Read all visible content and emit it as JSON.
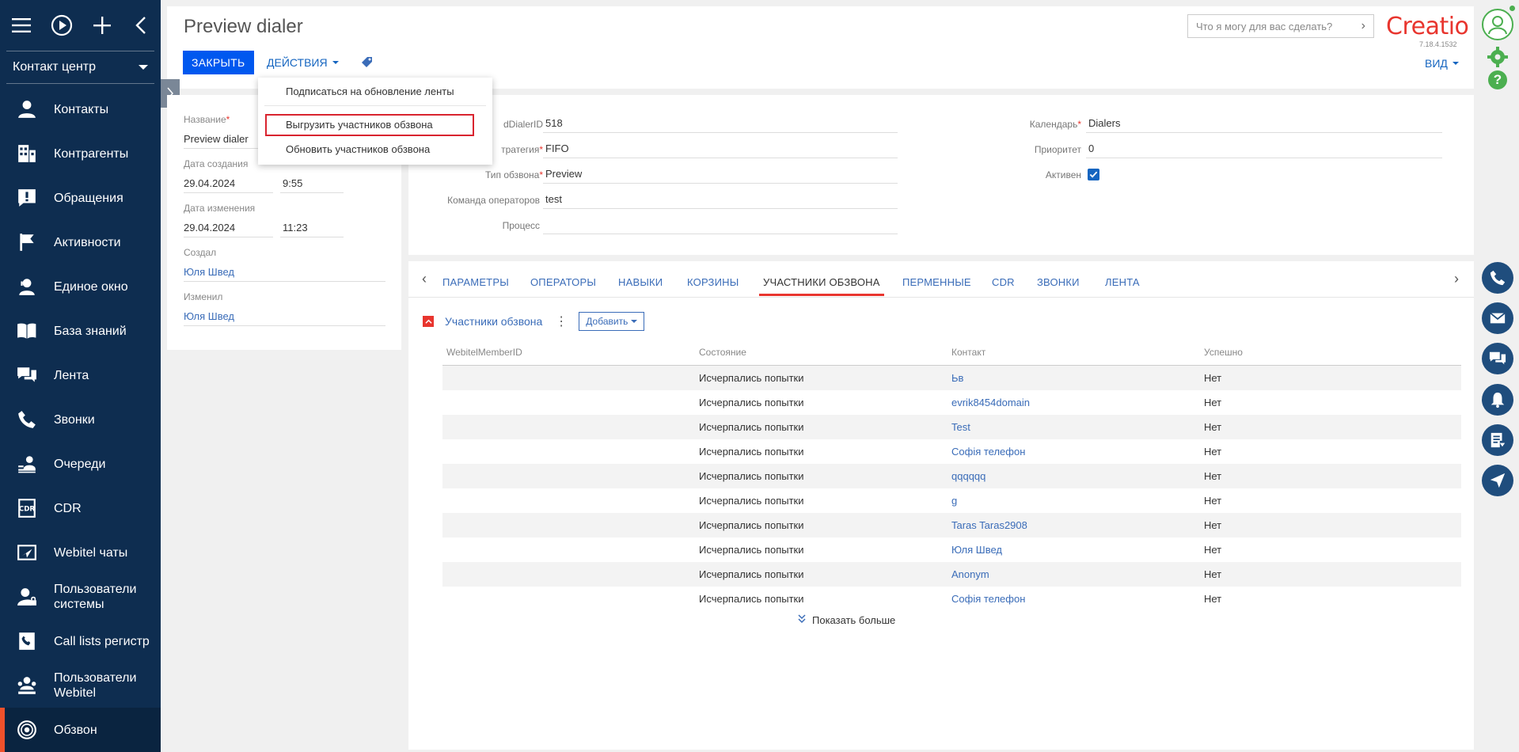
{
  "sidebar": {
    "section": "Контакт центр",
    "items": [
      {
        "label": "Контакты",
        "icon": "person-icon"
      },
      {
        "label": "Контрагенты",
        "icon": "building-icon"
      },
      {
        "label": "Обращения",
        "icon": "alert-icon"
      },
      {
        "label": "Активности",
        "icon": "flag-icon"
      },
      {
        "label": "Единое окно",
        "icon": "agent-icon"
      },
      {
        "label": "База знаний",
        "icon": "book-icon"
      },
      {
        "label": "Лента",
        "icon": "chat-icon"
      },
      {
        "label": "Звонки",
        "icon": "phone-icon"
      },
      {
        "label": "Очереди",
        "icon": "queue-icon"
      },
      {
        "label": "CDR",
        "icon": "cdr-icon"
      },
      {
        "label": "Webitel чаты",
        "icon": "send-icon"
      },
      {
        "label": "Пользователи системы",
        "icon": "user-lock-icon"
      },
      {
        "label": "Call lists регистр",
        "icon": "call-list-icon"
      },
      {
        "label": "Пользователи Webitel",
        "icon": "users-icon"
      },
      {
        "label": "Обзвон",
        "icon": "dialer-icon"
      }
    ]
  },
  "header": {
    "title": "Preview dialer",
    "close_label": "ЗАКРЫТЬ",
    "actions_label": "ДЕЙСТВИЯ",
    "search_placeholder": "Что я могу для вас сделать?",
    "logo": "Creatio",
    "version": "7.18.4.1532",
    "view_label": "ВИД"
  },
  "dropdown": {
    "items": [
      "Подписаться на обновление ленты",
      "Выгрузить участников обзвона",
      "Обновить участников обзвона"
    ]
  },
  "left_card": {
    "name_label": "Название",
    "name_value": "Preview dialer",
    "created_label": "Дата создания",
    "created_date": "29.04.2024",
    "created_time": "9:55",
    "modified_label": "Дата изменения",
    "modified_date": "29.04.2024",
    "modified_time": "11:23",
    "created_by_label": "Создал",
    "created_by": "Юля Швед",
    "modified_by_label": "Изменил",
    "modified_by": "Юля Швед"
  },
  "main_card": {
    "dialer_id_label": "dDialerID",
    "dialer_id": "518",
    "strategy_label": "тратегия",
    "strategy": "FIFO",
    "type_label": "Тип обзвона",
    "type": "Preview",
    "team_label": "Команда операторов",
    "team": "test",
    "process_label": "Процесс",
    "process": "",
    "calendar_label": "Календарь",
    "calendar": "Dialers",
    "priority_label": "Приоритет",
    "priority": "0",
    "active_label": "Активен"
  },
  "tabs": [
    "ПАРАМЕТРЫ",
    "ОПЕРАТОРЫ",
    "НАВЫКИ",
    "КОРЗИНЫ",
    "УЧАСТНИКИ ОБЗВОНА",
    "ПЕРМЕННЫЕ",
    "CDR",
    "ЗВОНКИ",
    "ЛЕНТА"
  ],
  "detail": {
    "title": "Участники обзвона",
    "add_label": "Добавить",
    "columns": [
      "WebitelMemberID",
      "Состояние",
      "Контакт",
      "Успешно"
    ],
    "rows": [
      [
        "",
        "Исчерпались попытки",
        "Ьв",
        "Нет"
      ],
      [
        "",
        "Исчерпались попытки",
        "evrik8454domain",
        "Нет"
      ],
      [
        "",
        "Исчерпались попытки",
        "Test",
        "Нет"
      ],
      [
        "",
        "Исчерпались попытки",
        "Софія телефон",
        "Нет"
      ],
      [
        "",
        "Исчерпались попытки",
        "qqqqqq",
        "Нет"
      ],
      [
        "",
        "Исчерпались попытки",
        "g",
        "Нет"
      ],
      [
        "",
        "Исчерпались попытки",
        "Taras Taras2908",
        "Нет"
      ],
      [
        "",
        "Исчерпались попытки",
        "Юля Швед",
        "Нет"
      ],
      [
        "",
        "Исчерпались попытки",
        "Anonym",
        "Нет"
      ],
      [
        "",
        "Исчерпались попытки",
        "Софія телефон",
        "Нет"
      ]
    ],
    "show_more": "Показать больше"
  }
}
